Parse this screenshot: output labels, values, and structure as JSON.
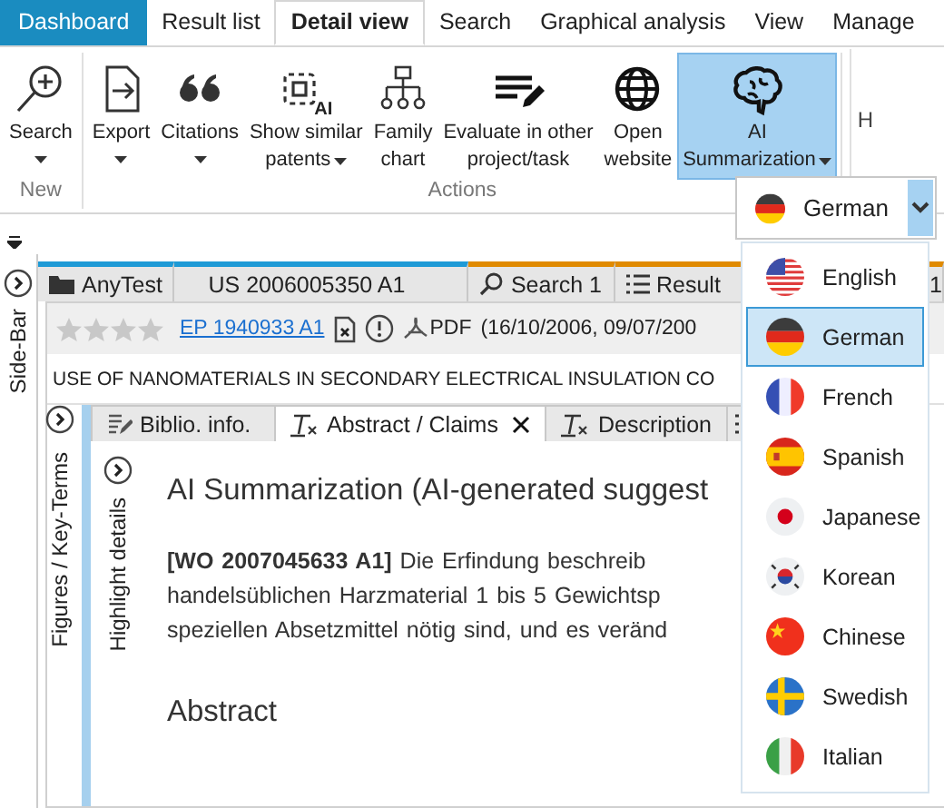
{
  "top_tabs": [
    {
      "label": "Dashboard",
      "kind": "home",
      "selected": false
    },
    {
      "label": "Result list",
      "kind": "tab",
      "selected": false
    },
    {
      "label": "Detail view",
      "kind": "tab",
      "selected": true
    },
    {
      "label": "Search",
      "kind": "tab",
      "selected": false
    },
    {
      "label": "Graphical analysis",
      "kind": "tab",
      "selected": false
    },
    {
      "label": "View",
      "kind": "tab",
      "selected": false
    },
    {
      "label": "Manage",
      "kind": "tab",
      "selected": false
    }
  ],
  "ribbon": {
    "groups": [
      {
        "label": "New",
        "buttons": [
          {
            "lines": [
              "Search"
            ],
            "dropdown": true,
            "selected": false
          }
        ]
      },
      {
        "label": "Actions",
        "buttons": [
          {
            "lines": [
              "Export"
            ],
            "dropdown": true,
            "selected": false
          },
          {
            "lines": [
              "Citations"
            ],
            "dropdown": true,
            "selected": false
          },
          {
            "lines": [
              "Show similar",
              "patents"
            ],
            "badge": "AI",
            "dropdown": true,
            "selected": false
          },
          {
            "lines": [
              "Family",
              "chart"
            ],
            "dropdown": false,
            "selected": false
          },
          {
            "lines": [
              "Evaluate in other",
              "project/task"
            ],
            "dropdown": false,
            "selected": false
          },
          {
            "lines": [
              "Open",
              "website"
            ],
            "dropdown": false,
            "selected": false
          },
          {
            "lines": [
              "AI",
              "Summarization"
            ],
            "dropdown": true,
            "selected": true
          }
        ]
      }
    ],
    "overflow_label": "H"
  },
  "language_picker": {
    "value": "German",
    "options": [
      {
        "label": "English",
        "selected": false
      },
      {
        "label": "German",
        "selected": true
      },
      {
        "label": "French",
        "selected": false
      },
      {
        "label": "Spanish",
        "selected": false
      },
      {
        "label": "Japanese",
        "selected": false
      },
      {
        "label": "Korean",
        "selected": false
      },
      {
        "label": "Chinese",
        "selected": false
      },
      {
        "label": "Swedish",
        "selected": false
      },
      {
        "label": "Italian",
        "selected": false
      }
    ]
  },
  "side_bar": {
    "label": "Side-Bar"
  },
  "doc_tabs": [
    {
      "label": "AnyTest",
      "color": "#1e9ad6"
    },
    {
      "label": "US 2006005350 A1",
      "color": "#1e9ad6"
    },
    {
      "label": "Search 1",
      "color": "#e08a00"
    },
    {
      "label": "Result",
      "color": "#e08a00"
    },
    {
      "label": "1",
      "color": "#e08a00"
    }
  ],
  "document": {
    "stars": 0,
    "number": "EP 1940933 A1",
    "pdf_label": "PDF",
    "dates": "(16/10/2006, 09/07/200",
    "title": "USE OF NANOMATERIALS IN SECONDARY ELECTRICAL INSULATION CO"
  },
  "figures_panel": {
    "label": "Figures / Key-Terms"
  },
  "content_tabs": [
    {
      "label": "Biblio. info.",
      "selected": false,
      "closable": false
    },
    {
      "label": "Abstract / Claims",
      "selected": true,
      "closable": true
    },
    {
      "label": "Description",
      "selected": false,
      "closable": false
    },
    {
      "selected": false,
      "closable": false
    }
  ],
  "highlight_panel": {
    "label": "Highlight details"
  },
  "summary": {
    "heading": "AI Summarization (AI-generated suggest",
    "lines": [
      "**[WO 2007045633 A1]** Die Erfindung beschreib",
      "handelsüblichen Harzmaterial 1 bis 5 Gewichtsp",
      "speziellen Absetzmittel nötig sind, und es veränd"
    ]
  },
  "abstract": {
    "heading": "Abstract"
  }
}
